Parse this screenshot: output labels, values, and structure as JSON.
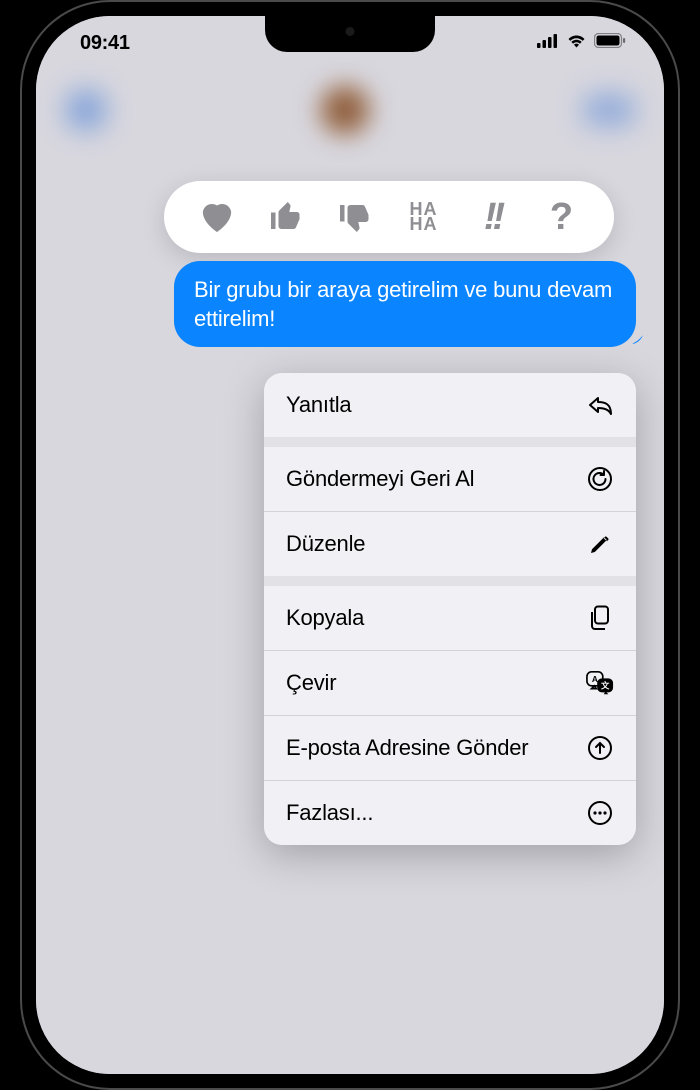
{
  "status": {
    "time": "09:41"
  },
  "message": {
    "text": "Bir grubu bir araya getirelim ve bunu devam ettirelim!"
  },
  "tapback": {
    "hahaTop": "HA",
    "hahaBottom": "HA",
    "exclaim": "!!",
    "question": "?"
  },
  "menu": {
    "reply": "Yanıtla",
    "undoSend": "Göndermeyi Geri Al",
    "edit": "Düzenle",
    "copy": "Kopyala",
    "translate": "Çevir",
    "sendEmail": "E-posta Adresine Gönder",
    "more": "Fazlası..."
  }
}
